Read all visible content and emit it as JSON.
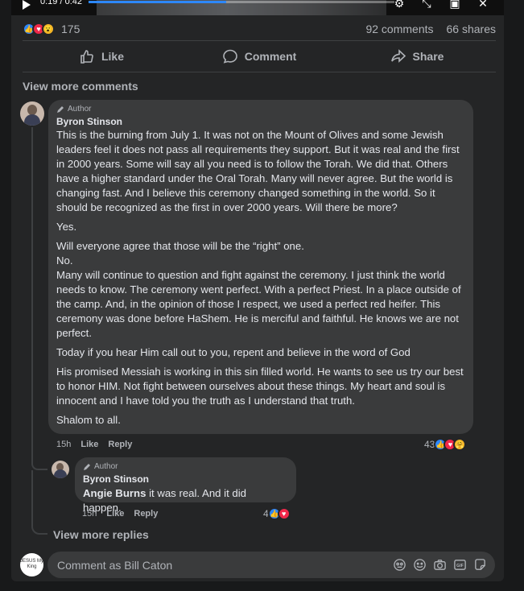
{
  "video": {
    "time": "0:19 / 0:42",
    "progress_fraction": 0.45
  },
  "post": {
    "reaction_count": "175",
    "comments_label": "92 comments",
    "shares_label": "66 shares",
    "reaction_icons": [
      "like",
      "love",
      "wow"
    ]
  },
  "actions": {
    "like": "Like",
    "comment": "Comment",
    "share": "Share"
  },
  "view_more_comments": "View more comments",
  "comment": {
    "badge": "Author",
    "name": "Byron Stinson",
    "paragraphs": [
      "This is the burning from July 1. It was not on the Mount of Olives and some Jewish leaders feel it does not pass all requirements they support. But it was real and the first in 2000 years. Some will say all you need is to follow the Torah. We did that. Others have a higher standard under the Oral Torah. Many will never agree. But the world is changing fast. And I believe this ceremony changed something in the world. So it should be recognized as the first in over 2000 years. Will there be more?",
      "Yes.",
      "Will everyone agree that those will be the “right” one.",
      "No.",
      "Many will continue to question and fight against the ceremony. I just think the world needs to know. The ceremony went perfect. With a perfect Priest. In a place outside of the camp. And, in the opinion of those I respect, we used a perfect red heifer. This ceremony was done before HaShem. He is merciful and faithful. He knows we are not perfect.",
      "Today if you hear Him call out to you, repent and believe in the word of God",
      "His promised Messiah is working in this sin filled world. He wants to see us try our best to honor HIM. Not fight between ourselves about these things. My heart and soul is innocent and I have told you the truth as I understand that truth.",
      "Shalom to all."
    ],
    "time": "15h",
    "like": "Like",
    "reply": "Reply",
    "reaction_count": "43",
    "reaction_icons": [
      "like",
      "love",
      "care"
    ]
  },
  "reply": {
    "badge": "Author",
    "name": "Byron Stinson",
    "mention": "Angie Burns",
    "text": " it was real. And it did happen.",
    "time": "15h",
    "like": "Like",
    "reply": "Reply",
    "reaction_count": "4",
    "reaction_icons": [
      "like",
      "love"
    ]
  },
  "view_more_replies": "View more replies",
  "composer": {
    "placeholder": "Comment as Bill Caton",
    "avatar_text": "JESUS My King",
    "tools": [
      "avatar-sticker-icon",
      "emoji-icon",
      "camera-icon",
      "gif-icon",
      "sticker-icon"
    ]
  }
}
